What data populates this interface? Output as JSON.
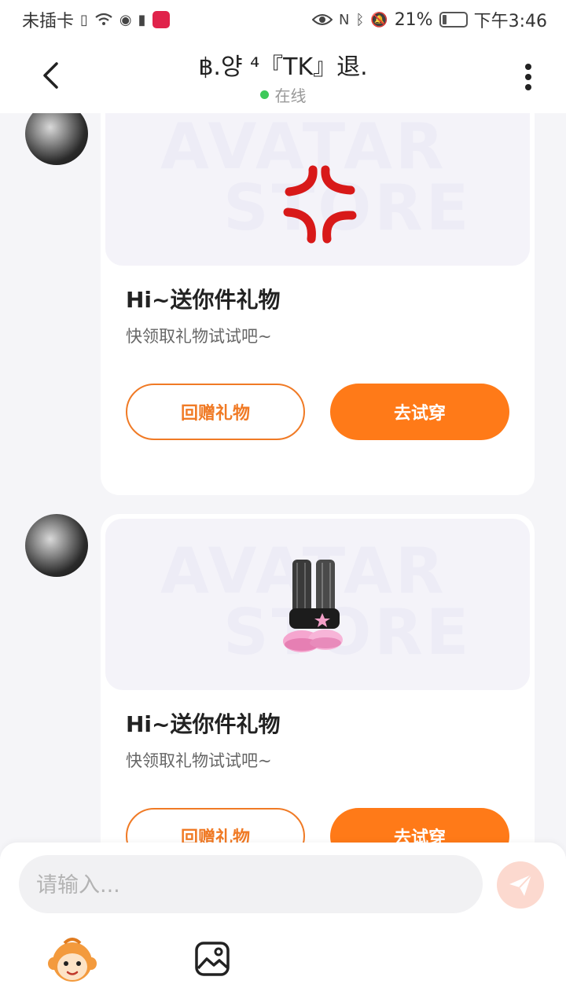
{
  "status_bar": {
    "carrier": "未插卡",
    "battery": "21%",
    "time": "下午3:46"
  },
  "header": {
    "title": "฿.양 ⁴『TK』退.",
    "status": "在线"
  },
  "watermark": {
    "line1": "AVATAR",
    "line2": "STORE"
  },
  "messages": [
    {
      "title": "Hi~送你件礼物",
      "subtitle": "快领取礼物试试吧~",
      "btn_return": "回赠礼物",
      "btn_try": "去试穿",
      "gift_icon": "angry-vein-icon"
    },
    {
      "title": "Hi~送你件礼物",
      "subtitle": "快领取礼物试试吧~",
      "btn_return": "回赠礼物",
      "btn_try": "去试穿",
      "gift_icon": "leg-warmer-shoes-icon"
    }
  ],
  "input": {
    "placeholder": "请输入..."
  },
  "colors": {
    "accent": "#ff7a18",
    "online": "#3ec95a",
    "send_disabled": "#fcd9cf"
  }
}
